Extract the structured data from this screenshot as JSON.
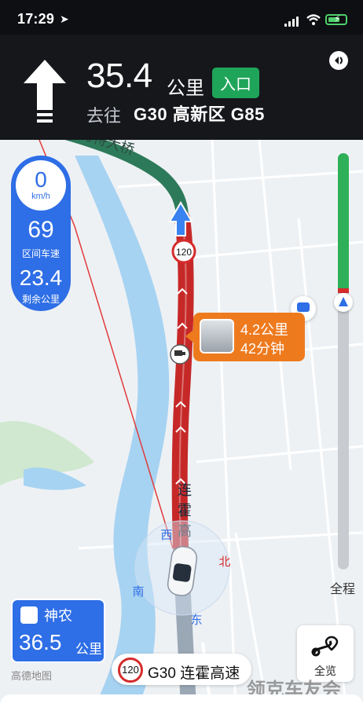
{
  "status_bar": {
    "time": "17:29"
  },
  "nav_header": {
    "distance": "35.4",
    "unit": "公里",
    "badge": "入口",
    "goto_label": "去往",
    "destination": "G30 高新区 G85"
  },
  "speed_panel": {
    "current_speed": "0",
    "speed_unit": "km/h",
    "avg_speed": "69",
    "avg_speed_label": "区间车速",
    "remaining": "23.4",
    "remaining_label": "剩余公里"
  },
  "map": {
    "bridge_label": "清河特大桥",
    "road_label_vertical": [
      "连",
      "霍",
      "高"
    ],
    "speed_limit_marker": "120",
    "compass": {
      "west": "西",
      "north": "北",
      "south": "南",
      "east": "东"
    }
  },
  "camera_card": {
    "distance": "4.2公里",
    "time": "42分钟"
  },
  "destination_card": {
    "name": "神农",
    "distance": "36.5",
    "unit": "公里"
  },
  "logo_text": "高德地图",
  "progress_bar": {
    "label": "全程",
    "progress_fraction": 0.34
  },
  "overview_button": {
    "label": "全览"
  },
  "road_pill": {
    "speed_limit": "120",
    "road_name": "G30 连霍高速"
  },
  "watermark": "领克车友会",
  "colors": {
    "route_red": "#c62828",
    "speed_blue": "#2e6ee6",
    "alert_orange": "#ee7a1e",
    "highway_green": "#2d7a5a",
    "river_blue": "#a7d3f2"
  }
}
